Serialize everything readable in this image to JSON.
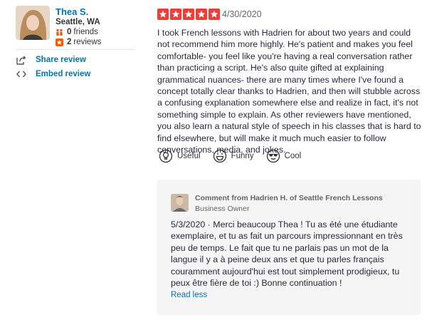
{
  "user": {
    "name": "Thea S.",
    "location": "Seattle, WA",
    "friends_count": "0",
    "friends_label": "friends",
    "reviews_count": "2",
    "reviews_label": "reviews"
  },
  "actions": {
    "share": "Share review",
    "embed": "Embed review"
  },
  "review": {
    "rating": 5,
    "date": "4/30/2020",
    "text": "I took French lessons with Hadrien for about two years and could not recommend him more highly. He's patient and makes you feel comfortable- you feel like you're having a real conversation rather than practicing a script. He's also quite gifted at explaining grammatical nuances- there are many times where I've found a concept totally clear thanks to Hadrien, and then will stubble across a confusing explanation somewhere else and realize in fact, it's not something simple to explain. As other reviewers have mentioned, you also learn a natural style of speech in his classes that is hard to find elsewhere, but will make it much much easier to follow conversations, media, and jokes."
  },
  "reactions": {
    "useful": "Useful",
    "funny": "Funny",
    "cool": "Cool"
  },
  "owner_comment": {
    "title": "Comment from Hadrien H. of Seattle French Lessons",
    "role": "Business Owner",
    "text": "5/3/2020 · Merci beaucoup Thea ! Tu as été une étudiante exemplaire, et tu as fait un parcours impressionnant en très peu de temps. Le fait que tu ne parlais pas un mot de la langue il y a à peine deux ans et que tu parles français couramment aujourd'hui est tout simplement prodigieux, tu peux être fière de toi :) Bonne continuation !",
    "read_less": "Read less"
  },
  "colors": {
    "link": "#0073bb",
    "star": "#f43939",
    "comment_bg": "#f5f5f5"
  },
  "icons": [
    "friends-icon",
    "reviews-icon",
    "share-icon",
    "embed-icon",
    "star-icon",
    "useful-icon",
    "funny-icon",
    "cool-icon"
  ]
}
